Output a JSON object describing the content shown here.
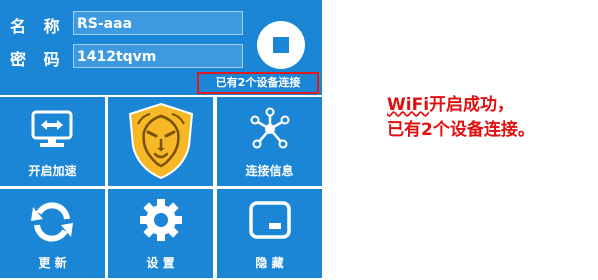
{
  "hotspot": {
    "name_label": "名 称",
    "name_value": "RS-aaa",
    "password_label": "密 码",
    "password_value": "1412tqvm",
    "status_text": "已有2个设备连接"
  },
  "tiles": {
    "accelerate": "开启加速",
    "connection_info": "连接信息",
    "refresh": "更 新",
    "settings": "设 置",
    "hide": "隐 藏"
  },
  "note": {
    "wifi": "WiFi",
    "line1_rest": "开启成功，",
    "line2": "已有2个设备连接。"
  },
  "colors": {
    "panel_blue": "#1b86d6",
    "alert_red": "#e01b1b",
    "shield_gold": "#f6b826"
  },
  "icons": {
    "accelerate": "monitor-arrows-icon",
    "logo": "lion-shield-icon",
    "connection_info": "network-nodes-icon",
    "refresh": "refresh-icon",
    "settings": "gear-icon",
    "hide": "hide-window-icon",
    "stop": "stop-icon"
  }
}
